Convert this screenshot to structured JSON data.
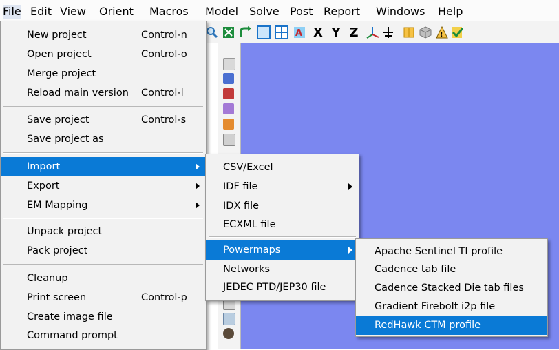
{
  "menubar": [
    "File",
    "Edit",
    "View",
    "Orient",
    "Macros",
    "Model",
    "Solve",
    "Post",
    "Report",
    "Windows",
    "Help"
  ],
  "toolbar": {
    "x": "X",
    "y": "Y",
    "z": "Z"
  },
  "file_menu": {
    "items": [
      {
        "label": "New project",
        "shortcut": "Control-n"
      },
      {
        "label": "Open project",
        "shortcut": "Control-o"
      },
      {
        "label": "Merge project",
        "shortcut": ""
      },
      {
        "label": "Reload main version",
        "shortcut": "Control-l"
      },
      {
        "label": "Save project",
        "shortcut": "Control-s"
      },
      {
        "label": "Save project as",
        "shortcut": ""
      },
      {
        "label": "Import",
        "shortcut": ""
      },
      {
        "label": "Export",
        "shortcut": ""
      },
      {
        "label": "EM Mapping",
        "shortcut": ""
      },
      {
        "label": "Unpack project",
        "shortcut": ""
      },
      {
        "label": "Pack project",
        "shortcut": ""
      },
      {
        "label": "Cleanup",
        "shortcut": ""
      },
      {
        "label": "Print screen",
        "shortcut": "Control-p"
      },
      {
        "label": "Create image file",
        "shortcut": ""
      },
      {
        "label": "Command prompt",
        "shortcut": ""
      }
    ]
  },
  "import_menu": {
    "items": [
      {
        "label": "CSV/Excel"
      },
      {
        "label": "IDF file"
      },
      {
        "label": "IDX file"
      },
      {
        "label": "ECXML file"
      },
      {
        "label": "Powermaps"
      },
      {
        "label": "Networks"
      },
      {
        "label": "JEDEC PTD/JEP30 file"
      }
    ]
  },
  "powermaps_menu": {
    "items": [
      {
        "label": "Apache Sentinel TI profile"
      },
      {
        "label": "Cadence tab file"
      },
      {
        "label": "Cadence Stacked Die tab files"
      },
      {
        "label": "Gradient Firebolt i2p file"
      },
      {
        "label": "RedHawk CTM profile"
      }
    ]
  }
}
